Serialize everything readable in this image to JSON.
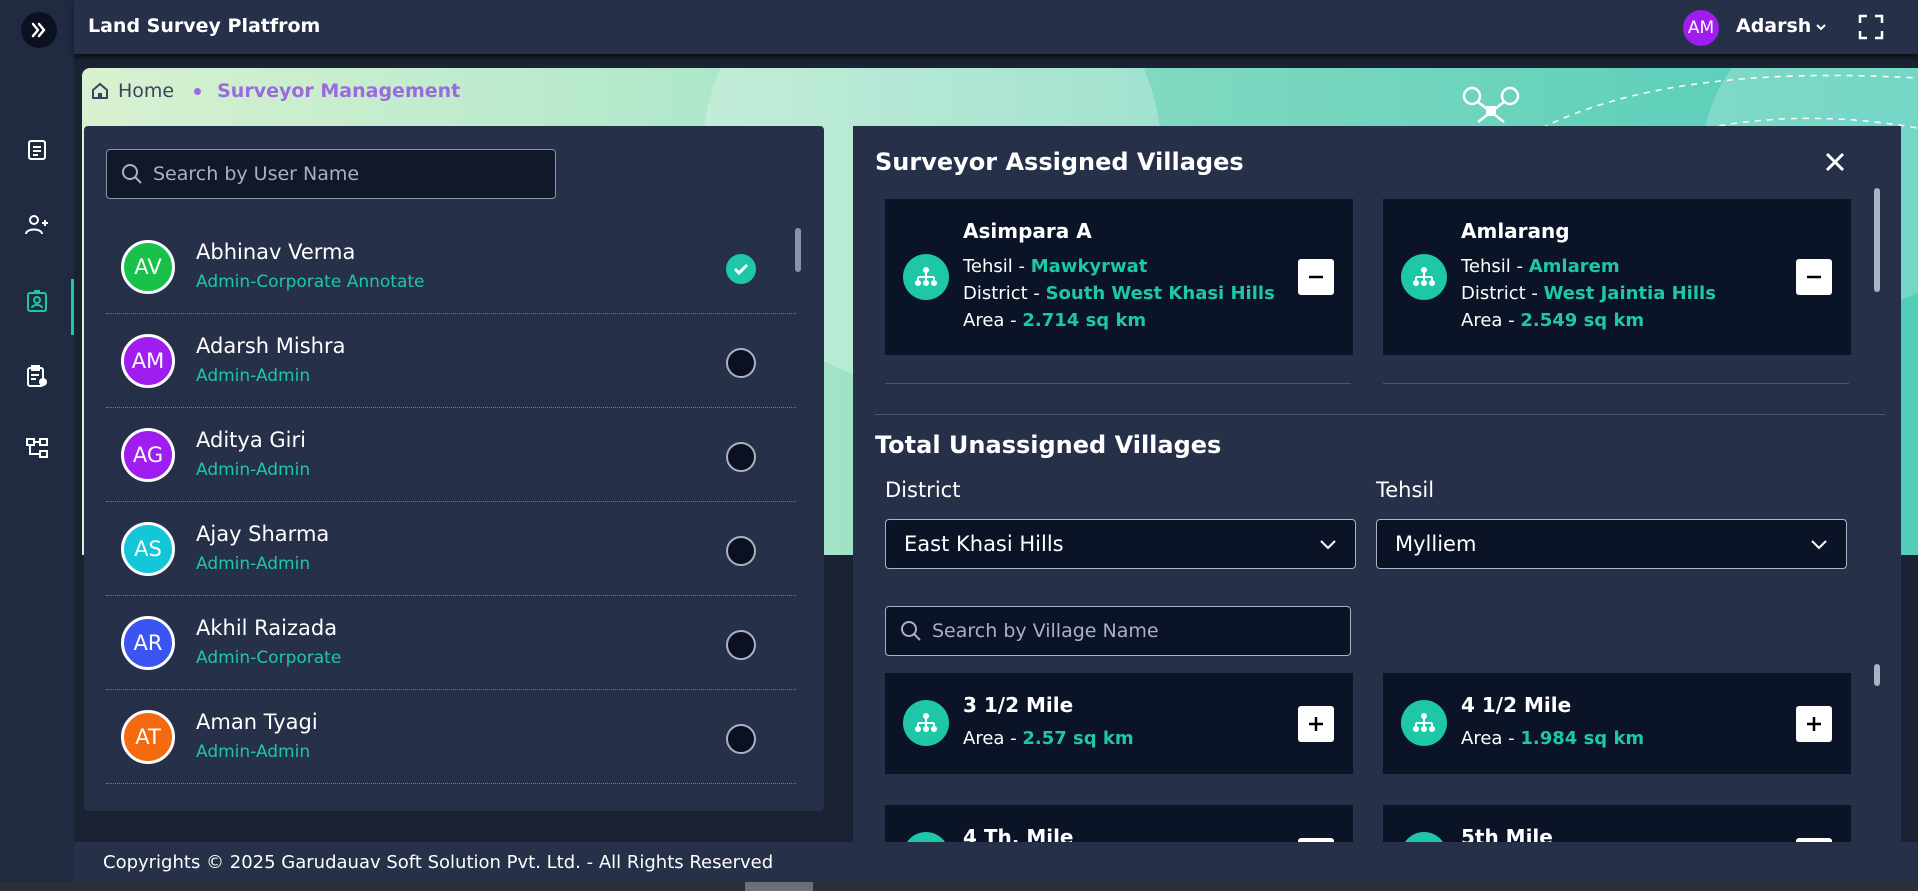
{
  "app": {
    "title": "Land Survey Platfrom"
  },
  "user": {
    "initials": "AM",
    "name": "Adarsh",
    "avatar_color": "#a01df0"
  },
  "sidebar": {
    "items": [
      {
        "icon": "document-icon"
      },
      {
        "icon": "add-user-icon"
      },
      {
        "icon": "surveyor-badge-icon",
        "active": true
      },
      {
        "icon": "clipboard-settings-icon"
      },
      {
        "icon": "hierarchy-icon"
      }
    ]
  },
  "breadcrumb": {
    "home": "Home",
    "current": "Surveyor Management"
  },
  "users": {
    "search_placeholder": "Search by User Name",
    "list": [
      {
        "initials": "AV",
        "name": "Abhinav Verma",
        "role": "Admin-Corporate Annotate",
        "color": "#18c24a",
        "selected": true
      },
      {
        "initials": "AM",
        "name": "Adarsh Mishra",
        "role": "Admin-Admin",
        "color": "#a01df0",
        "selected": false
      },
      {
        "initials": "AG",
        "name": "Aditya Giri",
        "role": "Admin-Admin",
        "color": "#a01df0",
        "selected": false
      },
      {
        "initials": "AS",
        "name": "Ajay Sharma",
        "role": "Admin-Admin",
        "color": "#13c6d8",
        "selected": false
      },
      {
        "initials": "AR",
        "name": "Akhil Raizada",
        "role": "Admin-Corporate",
        "color": "#3a55f0",
        "selected": false
      },
      {
        "initials": "AT",
        "name": "Aman Tyagi",
        "role": "Admin-Admin",
        "color": "#f36a10",
        "selected": false
      }
    ]
  },
  "assigned": {
    "title": "Surveyor Assigned Villages",
    "villages": [
      {
        "name": "Asimpara A",
        "tehsil_label": "Tehsil - ",
        "tehsil": "Mawkyrwat",
        "district_label": "District - ",
        "district": "South West Khasi Hills",
        "area_label": "Area - ",
        "area": "2.714 sq km"
      },
      {
        "name": "Amlarang",
        "tehsil_label": "Tehsil - ",
        "tehsil": "Amlarem",
        "district_label": "District - ",
        "district": "West Jaintia Hills",
        "area_label": "Area - ",
        "area": "2.549 sq km"
      }
    ]
  },
  "unassigned": {
    "title": "Total Unassigned Villages",
    "district_label": "District",
    "district_value": "East Khasi Hills",
    "tehsil_label": "Tehsil",
    "tehsil_value": "Mylliem",
    "search_placeholder": "Search by Village Name",
    "villages": [
      {
        "name": "3 1/2 Mile",
        "area_label": "Area - ",
        "area": "2.57 sq km"
      },
      {
        "name": "4 1/2 Mile",
        "area_label": "Area - ",
        "area": "1.984 sq km"
      },
      {
        "name": "4 Th. Mile"
      },
      {
        "name": "5th Mile"
      }
    ]
  },
  "footer": {
    "text": "Copyrights © 2025 Garudauav Soft Solution Pvt. Ltd. - All Rights Reserved"
  },
  "colors": {
    "accent": "#1dc7a8",
    "panel": "#263048",
    "card": "#0b1427",
    "breadcrumb_active": "#9a6bdc"
  }
}
